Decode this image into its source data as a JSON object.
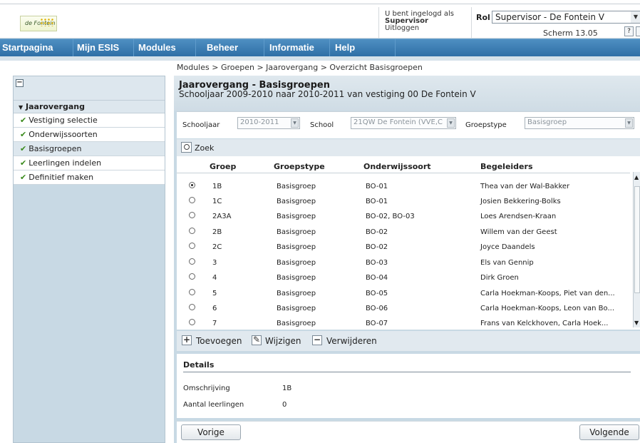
{
  "header": {
    "logo_text": "de Fontein",
    "login_text": "U bent ingelogd als",
    "user_role": "Supervisor",
    "logout": "Uitloggen",
    "rol_label": "Rol",
    "rol_value": "Supervisor - De Fontein V",
    "scherm": "Scherm 13.05",
    "help_label": "?"
  },
  "nav": {
    "items": [
      "Startpagina",
      "Mijn ESIS",
      "Modules",
      "Beheer",
      "Informatie",
      "Help"
    ]
  },
  "breadcrumb": "Modules > Groepen > Jaarovergang > Overzicht Basisgroepen",
  "sidebar": {
    "collapse_symbol": "−",
    "section": "Jaarovergang",
    "section_arrow": "▼",
    "check_glyph": "✔",
    "items": [
      {
        "label": "Vestiging selectie"
      },
      {
        "label": "Onderwijssoorten"
      },
      {
        "label": "Basisgroepen"
      },
      {
        "label": "Leerlingen indelen"
      },
      {
        "label": "Definitief maken"
      }
    ]
  },
  "main": {
    "title": "Jaarovergang - Basisgroepen",
    "subtitle": "Schooljaar 2009-2010 naar 2010-2011 van vestiging 00 De Fontein V",
    "filters": {
      "schooljaar_label": "Schooljaar",
      "schooljaar_value": "2010-2011",
      "school_label": "School",
      "school_value": "21QW De Fontein (VVE,C",
      "groepstype_label": "Groepstype",
      "groepstype_value": "Basisgroep"
    },
    "zoek": "Zoek",
    "columns": [
      "Groep",
      "Groepstype",
      "Onderwijssoort",
      "Begeleiders"
    ],
    "rows": [
      {
        "groep": "1B",
        "type": "Basisgroep",
        "soort": "BO-01",
        "begeleiders": "Thea van der Wal-Bakker"
      },
      {
        "groep": "1C",
        "type": "Basisgroep",
        "soort": "BO-01",
        "begeleiders": "Josien Bekkering-Bolks"
      },
      {
        "groep": "2A3A",
        "type": "Basisgroep",
        "soort": "BO-02, BO-03",
        "begeleiders": "Loes Arendsen-Kraan"
      },
      {
        "groep": "2B",
        "type": "Basisgroep",
        "soort": "BO-02",
        "begeleiders": "Willem van der Geest"
      },
      {
        "groep": "2C",
        "type": "Basisgroep",
        "soort": "BO-02",
        "begeleiders": "Joyce Daandels"
      },
      {
        "groep": "3",
        "type": "Basisgroep",
        "soort": "BO-03",
        "begeleiders": "Els van Gennip"
      },
      {
        "groep": "4",
        "type": "Basisgroep",
        "soort": "BO-04",
        "begeleiders": "Dirk Groen"
      },
      {
        "groep": "5",
        "type": "Basisgroep",
        "soort": "BO-05",
        "begeleiders": "Carla Hoekman-Koops, Piet van den..."
      },
      {
        "groep": "6",
        "type": "Basisgroep",
        "soort": "BO-06",
        "begeleiders": "Carla Hoekman-Koops, Leon van Bo..."
      },
      {
        "groep": "7",
        "type": "Basisgroep",
        "soort": "BO-07",
        "begeleiders": "Frans van Kelckhoven, Carla Hoek..."
      }
    ],
    "actions": {
      "toevoegen": "Toevoegen",
      "wijzigen": "Wijzigen",
      "verwijderen": "Verwijderen",
      "plus": "+",
      "minus": "−"
    },
    "details": {
      "title": "Details",
      "omschrijving_label": "Omschrijving",
      "omschrijving_value": "1B",
      "aantal_label": "Aantal leerlingen",
      "aantal_value": "0"
    },
    "footer": {
      "vorige": "Vorige",
      "volgende": "Volgende"
    }
  }
}
